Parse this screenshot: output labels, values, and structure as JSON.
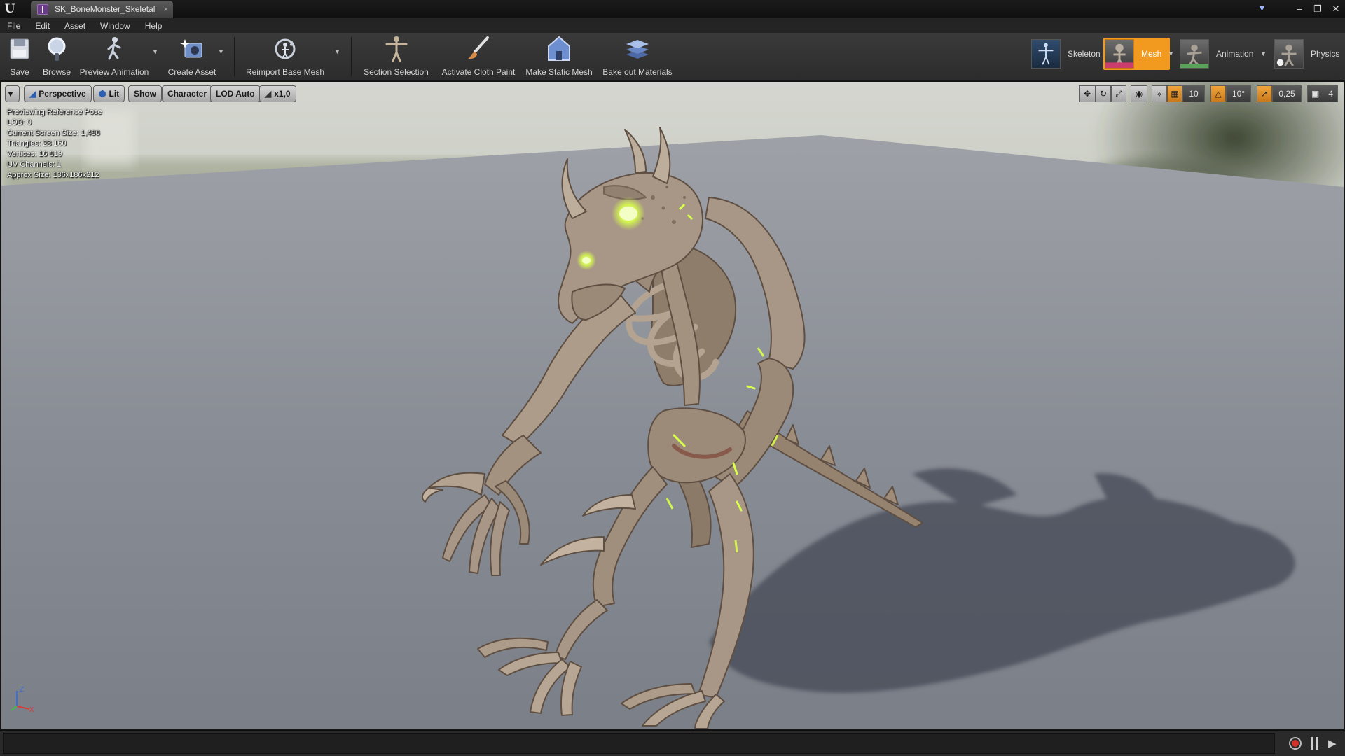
{
  "window": {
    "document_tab": "SK_BoneMonster_Skeletal",
    "close_glyph": "x"
  },
  "menu": [
    "File",
    "Edit",
    "Asset",
    "Window",
    "Help"
  ],
  "toolbar": {
    "save": "Save",
    "browse": "Browse",
    "preview_animation": "Preview Animation",
    "create_asset": "Create Asset",
    "reimport_base_mesh": "Reimport Base Mesh",
    "section_selection": "Section Selection",
    "activate_cloth_paint": "Activate Cloth Paint",
    "make_static_mesh": "Make Static Mesh",
    "bake_out_materials": "Bake out Materials"
  },
  "modes": {
    "skeleton": "Skeleton",
    "mesh": "Mesh",
    "animation": "Animation",
    "physics": "Physics",
    "active": "mesh"
  },
  "viewport": {
    "view_mode": "Perspective",
    "lighting": "Lit",
    "show": "Show",
    "character": "Character",
    "lod": "LOD Auto",
    "playback_speed": "x1,0",
    "grid_snap": "10",
    "rotate_snap": "10°",
    "scale_snap": "0,25",
    "camera_speed": "4",
    "stats": [
      "Previewing Reference Pose",
      "LOD: 0",
      "Current Screen Size: 1,486",
      "Triangles: 28 160",
      "Vertices: 16 619",
      "UV Channels: 1",
      "Approx Size: 136x186x212"
    ],
    "axis_labels": {
      "z": "Z",
      "x": "X"
    }
  },
  "colors": {
    "accent": "#f29a1f",
    "bone": "#a89786",
    "glow": "#d8ff4a",
    "floor": "#8b8f96",
    "record": "#d3322b"
  }
}
